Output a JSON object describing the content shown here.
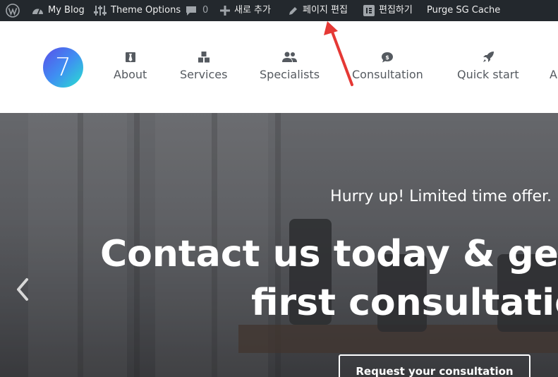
{
  "adminbar": {
    "wp_logo_icon": "wordpress-logo-icon",
    "site_name": "My Blog",
    "theme_options": "Theme Options",
    "comments_count": "0",
    "new_content": "새로 추가",
    "edit_page": "페이지 편집",
    "edit_elementor": "편집하기",
    "purge_cache": "Purge SG Cache"
  },
  "header": {
    "logo_text": "7",
    "nav": [
      {
        "label": "About",
        "icon": "tie-icon"
      },
      {
        "label": "Services",
        "icon": "boxes-icon"
      },
      {
        "label": "Specialists",
        "icon": "users-icon"
      },
      {
        "label": "Consultation",
        "icon": "comment-dollar-icon"
      },
      {
        "label": "Quick start",
        "icon": "rocket-icon"
      },
      {
        "label": "A",
        "icon": "more-icon"
      }
    ]
  },
  "hero": {
    "subtitle": "Hurry up! Limited time offer.",
    "title_line1": "Contact us today & ge",
    "title_line2": "first consultatio",
    "cta_label": "Request your consultation"
  },
  "colors": {
    "adminbar_bg": "#23282d",
    "annotation_arrow": "#e53935",
    "nav_text": "#555a60"
  }
}
